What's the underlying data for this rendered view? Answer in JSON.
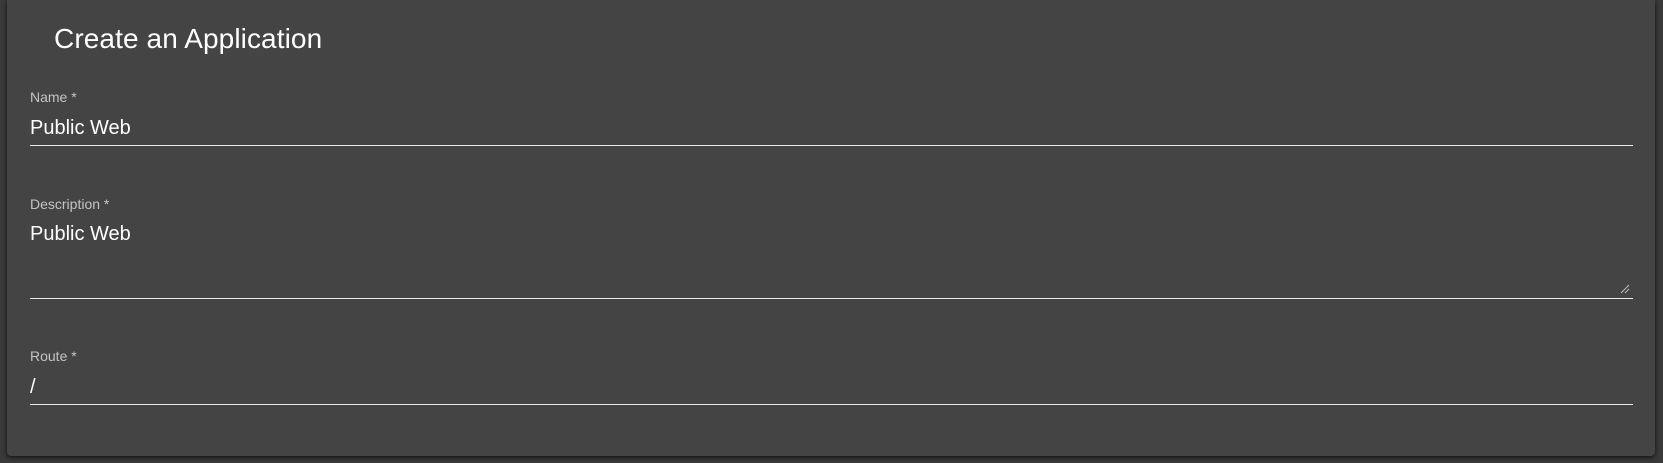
{
  "form": {
    "title": "Create an Application",
    "fields": {
      "name": {
        "label": "Name *",
        "value": "Public Web"
      },
      "description": {
        "label": "Description *",
        "value": "Public Web"
      },
      "route": {
        "label": "Route *",
        "value": "/"
      }
    }
  },
  "icons": {
    "resize": "resize-grip-icon"
  },
  "colors": {
    "page_background": "#3a3a3a",
    "card_background": "#444444",
    "text_primary": "#ffffff",
    "label_text": "#c4c4c4",
    "underline": "#e8e8e8"
  }
}
